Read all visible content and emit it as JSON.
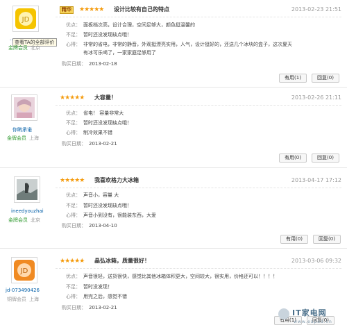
{
  "reviews": [
    {
      "username": "...",
      "level": "金牌会员",
      "location": "北京",
      "avatar_icon": "jd-avatar-yellow-icon",
      "essence_badge": "精华",
      "stars": "★★★★★",
      "title": "设计比较有自己的特点",
      "date": "2013-02-23 21:51",
      "pros_label": "优点：",
      "pros": "面板档次高，设计合理，空间足够大，颜色挺温馨的",
      "cons_label": "不足：",
      "cons": "暂时还没发现缺点哦！",
      "experience_label": "心得：",
      "experience": [
        "非常的省电，非常的静音，外观挺漂亮实用，人气，设计挺好的，还送几个冰块的盒子，这次夏天",
        "有冰可乐喝了，一家家庭足够用了"
      ],
      "purchase_label": "购买日期：",
      "purchase_date": "2013-02-18",
      "useful_label": "有用(1)",
      "reply_label": "回复(0)",
      "tooltip": "查看TA的全部评价"
    },
    {
      "username": "你啲承诺",
      "level": "金牌会员",
      "location": "上海",
      "avatar_icon": "person-avatar-icon",
      "stars": "★★★★★",
      "title": "大容量！",
      "date": "2013-02-26 21:11",
      "pros_label": "优点：",
      "pros": "省电！ 容量非常大",
      "cons_label": "不足：",
      "cons": "暂时还没发现缺点哦！",
      "experience_label": "心得：",
      "experience": [
        "制冷效果不错"
      ],
      "purchase_label": "购买日期：",
      "purchase_date": "2013-02-21",
      "useful_label": "有用(0)",
      "reply_label": "回复(0)"
    },
    {
      "username": "ineedyouzhai",
      "level": "金牌会员",
      "location": "北京",
      "avatar_icon": "photo-avatar-icon",
      "stars": "★★★★★",
      "title": "我喜欢格力大冰箱",
      "date": "2013-04-17 17:12",
      "pros_label": "优点：",
      "pros": "声音小，容量 大",
      "cons_label": "不足：",
      "cons": "暂时还没发现缺点哦！",
      "experience_label": "心得：",
      "experience": [
        "声音小到没有，很能装东西，大爱"
      ],
      "purchase_label": "购买日期：",
      "purchase_date": "2013-04-10",
      "useful_label": "有用(0)",
      "reply_label": "回复(0)"
    },
    {
      "username": "jd-073490426",
      "level": "铜牌会员",
      "location": "上海",
      "avatar_icon": "jd-avatar-orange-icon",
      "stars": "★★★★★",
      "title": "晶弘冰箱，质量很好！",
      "date": "2013-03-06 09:32",
      "pros_label": "优点：",
      "pros": "声音很轻，送货很快，感觉比其他冰箱体积更大，空间较大，很实用，价格还可以！！！！",
      "cons_label": "不足：",
      "cons": "暂时没发现！",
      "experience_label": "心得：",
      "experience": [
        "用完之后，感觉不错"
      ],
      "purchase_label": "购买日期：",
      "purchase_date": "2013-02-21",
      "useful_label": "有用(1)",
      "reply_label": "回复(0)"
    }
  ],
  "watermark": {
    "brand": "IT家电网",
    "url": "www.eapad.cn"
  },
  "colors": {
    "star": "#f49a0b",
    "gold_member": "#2f9a2f",
    "username": "#005ea7"
  }
}
